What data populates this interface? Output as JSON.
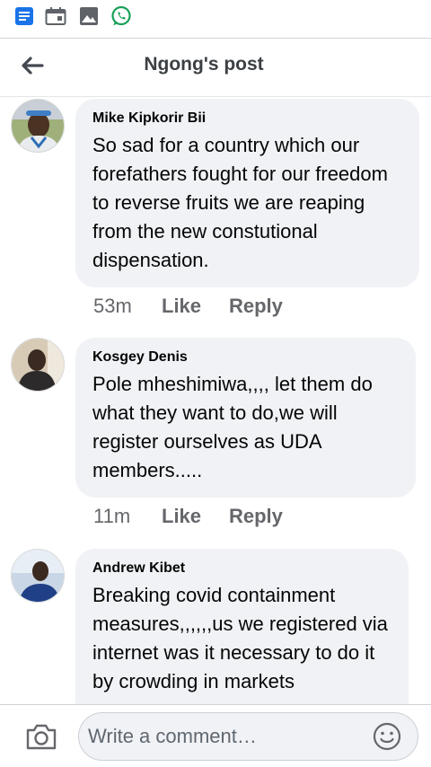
{
  "status_bar": {
    "icons": [
      "notes-icon",
      "calendar-icon",
      "gallery-icon",
      "whatsapp-icon"
    ]
  },
  "header": {
    "title": "Ngong's post",
    "back_icon": "arrow-left-icon"
  },
  "comments": [
    {
      "author": "Mike Kipkorir Bii",
      "text": "So sad for a country which our forefathers fought for our freedom to reverse fruits we are reaping from the new constutional dispensation.",
      "time": "53m",
      "like_label": "Like",
      "reply_label": "Reply"
    },
    {
      "author": "Kosgey Denis",
      "text": "Pole mheshimiwa,,,, let them do what they want to do,we will register ourselves as UDA members.....",
      "time": "11m",
      "like_label": "Like",
      "reply_label": "Reply"
    },
    {
      "author": "Andrew Kibet",
      "text": "Breaking covid containment measures,,,,,,us we registered via internet was it necessary to do it by crowding in markets"
    }
  ],
  "footer": {
    "placeholder": "Write a comment…",
    "camera_icon": "camera-icon",
    "emoji_icon": "smiley-icon"
  },
  "colors": {
    "bubble": "#f0f2f5",
    "meta": "#65676b",
    "accent_blue": "#1877f2",
    "whatsapp_green": "#1aa058"
  }
}
